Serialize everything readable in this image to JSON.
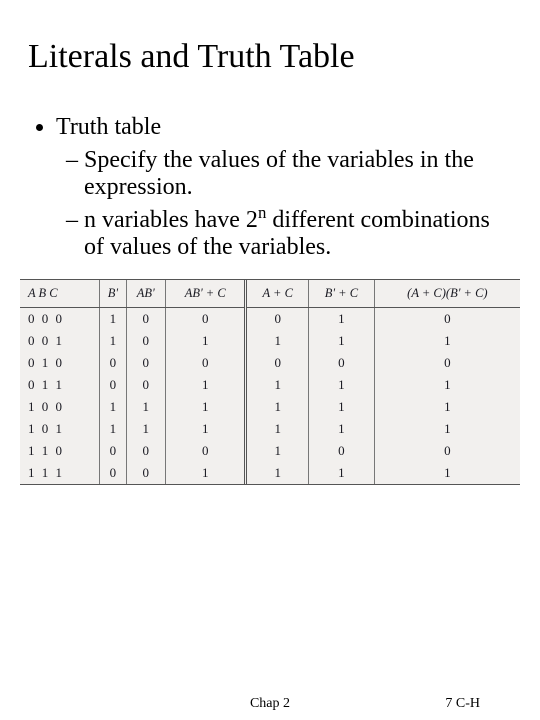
{
  "title": "Literals and Truth Table",
  "bullets": {
    "topic": "Truth table",
    "sub1": "Specify the values of the variables in the expression.",
    "sub2_pre": "n variables have 2",
    "sub2_sup": "n",
    "sub2_post": " different combinations of values of the variables."
  },
  "chart_data": {
    "type": "table",
    "headers": [
      "A B C",
      "B'",
      "AB'",
      "AB' + C",
      "A + C",
      "B' + C",
      "(A + C)(B' + C)"
    ],
    "rows": [
      {
        "abc": "0 0 0",
        "bp": "1",
        "abp": "0",
        "abpc": "0",
        "ac": "0",
        "bpc": "1",
        "prod": "0"
      },
      {
        "abc": "0 0 1",
        "bp": "1",
        "abp": "0",
        "abpc": "1",
        "ac": "1",
        "bpc": "1",
        "prod": "1"
      },
      {
        "abc": "0 1 0",
        "bp": "0",
        "abp": "0",
        "abpc": "0",
        "ac": "0",
        "bpc": "0",
        "prod": "0"
      },
      {
        "abc": "0 1 1",
        "bp": "0",
        "abp": "0",
        "abpc": "1",
        "ac": "1",
        "bpc": "1",
        "prod": "1"
      },
      {
        "abc": "1 0 0",
        "bp": "1",
        "abp": "1",
        "abpc": "1",
        "ac": "1",
        "bpc": "1",
        "prod": "1"
      },
      {
        "abc": "1 0 1",
        "bp": "1",
        "abp": "1",
        "abpc": "1",
        "ac": "1",
        "bpc": "1",
        "prod": "1"
      },
      {
        "abc": "1 1 0",
        "bp": "0",
        "abp": "0",
        "abpc": "0",
        "ac": "1",
        "bpc": "0",
        "prod": "0"
      },
      {
        "abc": "1 1 1",
        "bp": "0",
        "abp": "0",
        "abpc": "1",
        "ac": "1",
        "bpc": "1",
        "prod": "1"
      }
    ]
  },
  "footer": {
    "center": "Chap 2",
    "right": "7 C-H"
  }
}
